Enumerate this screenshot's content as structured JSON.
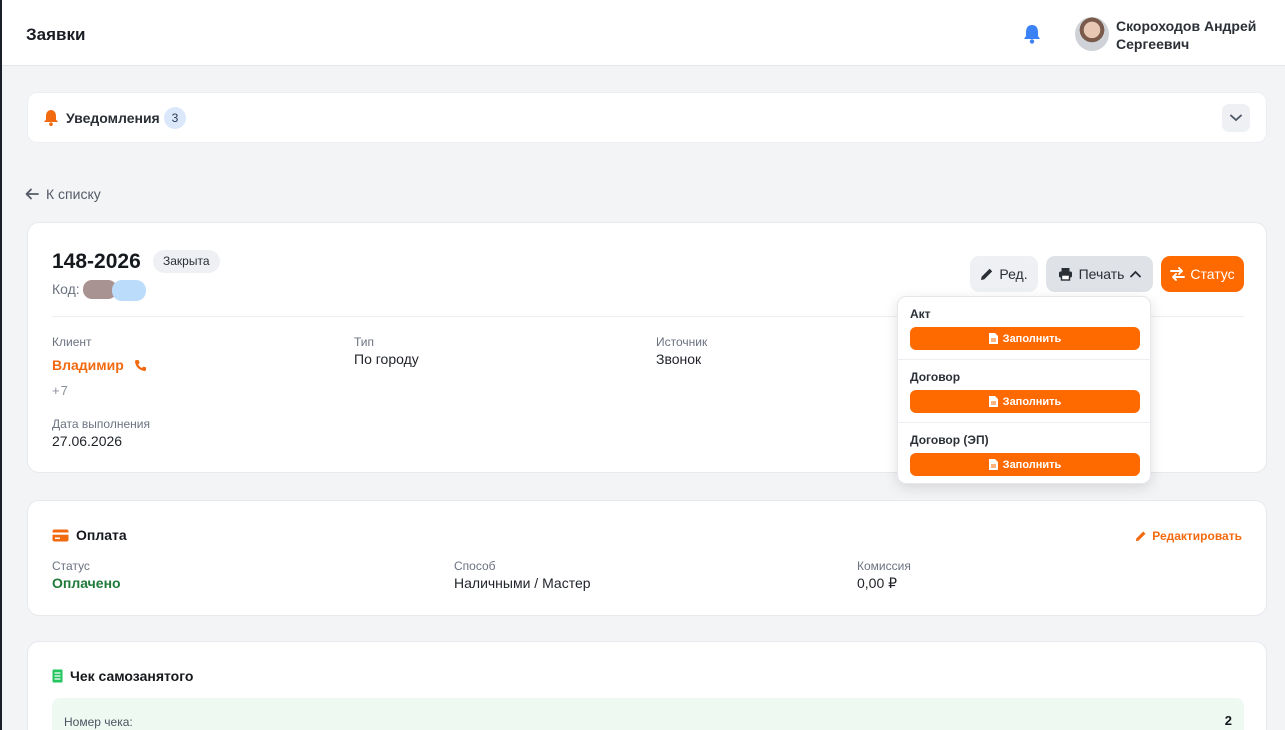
{
  "header": {
    "title": "Заявки",
    "user_name": "Скороходов Андрей Сергеевич"
  },
  "notifications": {
    "label": "Уведомления",
    "count": "3"
  },
  "nav": {
    "back_label": "К списку"
  },
  "order": {
    "number": "148-2026",
    "status": "Закрыта",
    "code_label": "Код:",
    "actions": {
      "edit": "Ред.",
      "print": "Печать",
      "status": "Статус"
    },
    "fields": {
      "client_label": "Клиент",
      "client_name": "Владимир",
      "client_phone": "+7",
      "type_label": "Тип",
      "type_value": "По городу",
      "source_label": "Источник",
      "source_value": "Звонок",
      "date_label": "Дата выполнения",
      "date_value": "27.06.2026"
    }
  },
  "print_menu": {
    "items": [
      {
        "title": "Акт",
        "button": "Заполнить"
      },
      {
        "title": "Договор",
        "button": "Заполнить"
      },
      {
        "title": "Договор (ЭП)",
        "button": "Заполнить"
      }
    ]
  },
  "payment": {
    "title": "Оплата",
    "edit_label": "Редактировать",
    "status_label": "Статус",
    "status_value": "Оплачено",
    "method_label": "Способ",
    "method_value": "Наличными / Мастер",
    "commission_label": "Комиссия",
    "commission_value": "0,00 ₽"
  },
  "receipt": {
    "title": "Чек самозанятого",
    "number_label": "Номер чека:",
    "number_value": "2"
  },
  "colors": {
    "accent": "#ff6a00",
    "paid": "#1f7a3a",
    "bell_header": "#3b82f6"
  }
}
